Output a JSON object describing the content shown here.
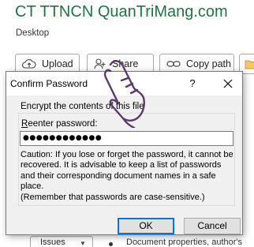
{
  "backstage": {
    "title": "CT TTNCN QuanTriMang.com",
    "location": "Desktop",
    "buttons": {
      "upload": "Upload",
      "share": "Share",
      "copy_path": "Copy path"
    },
    "issues_label": "Issues",
    "doc_properties_text": "Document properties, author's"
  },
  "dialog": {
    "title": "Confirm Password",
    "help": "?",
    "message": "Encrypt the contents of this file",
    "password_label_mnemonic": "R",
    "password_label_rest": "eenter password:",
    "password_value": "●●●●●●●●●●●●",
    "caution": "Caution: If you lose or forget the password, it cannot be recovered. It is advisable to keep a list of passwords and their corresponding document names in a safe place.",
    "caution_note": "(Remember that passwords are case-sensitive.)",
    "ok_label": "OK",
    "cancel_label": "Cancel"
  },
  "colors": {
    "accent_green": "#217346",
    "focus_blue": "#0078d7",
    "cursor_purple": "#5b3a6e"
  },
  "icons": [
    "upload-icon",
    "share-icon",
    "copy-path-icon",
    "folder-icon",
    "close-icon",
    "chevron-down-icon",
    "hand-cursor-icon"
  ]
}
